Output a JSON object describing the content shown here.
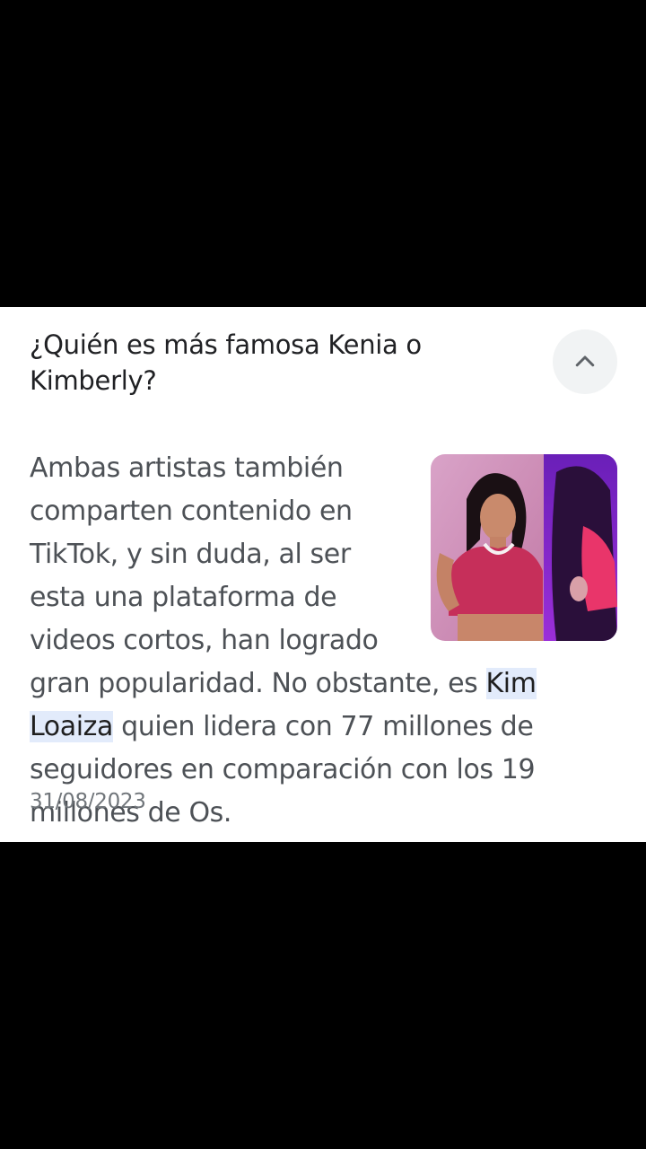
{
  "question": "¿Quién es más famosa Kenia o Kimberly?",
  "collapse_icon": "chevron-up-icon",
  "answer": {
    "text_before": "Ambas artistas también comparten contenido en TikTok, y sin duda, al ser esta una plataforma de videos cortos, han logrado gran popularidad. No obstante, es ",
    "highlight": "Kim Loaiza",
    "text_after": " quien lidera con 77 millones de seguidores en comparación con los 19 millones de Os."
  },
  "date": "31/08/2023",
  "colors": {
    "card_bg": "#ffffff",
    "page_bg": "#000000",
    "highlight_bg": "#e2ebfb",
    "text": "#4d5156"
  }
}
